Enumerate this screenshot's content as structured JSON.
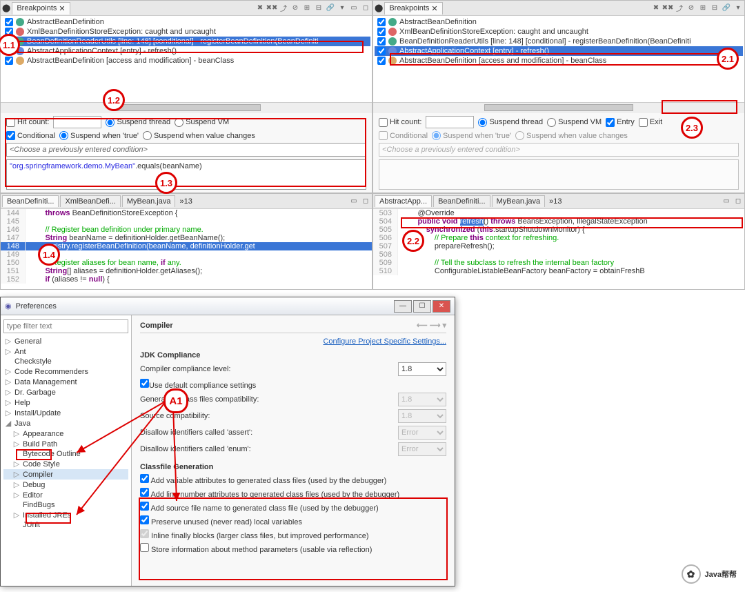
{
  "bp_view": {
    "title": "Breakpoints",
    "items": [
      {
        "checked": true,
        "icon": "class",
        "label": "AbstractBeanDefinition"
      },
      {
        "checked": true,
        "icon": "exc",
        "label": "XmlBeanDefinitionStoreException: caught and uncaught"
      },
      {
        "checked": true,
        "icon": "line",
        "label": "BeanDefinitionReaderUtils [line: 148] [conditional] - registerBeanDefinition(BeanDefiniti"
      },
      {
        "checked": true,
        "icon": "meth",
        "label": "AbstractApplicationContext [entry] - refresh()"
      },
      {
        "checked": true,
        "icon": "watch",
        "label": "AbstractBeanDefinition [access and modification] - beanClass"
      }
    ],
    "hit_count_label": "Hit count:",
    "suspend_thread": "Suspend thread",
    "suspend_vm": "Suspend VM",
    "conditional_label": "Conditional",
    "suspend_true": "Suspend when 'true'",
    "suspend_change": "Suspend when value changes",
    "cond_placeholder": "<Choose a previously entered condition>",
    "cond_expr_lit": "\"org.springframework.demo.MyBean\"",
    "cond_expr_rest": ".equals(beanName)",
    "entry_label": "Entry",
    "exit_label": "Exit"
  },
  "editors": {
    "left_tabs": [
      "BeanDefiniti...",
      "XmlBeanDefi...",
      "MyBean.java"
    ],
    "left_overflow": "»13",
    "right_tabs": [
      "AbstractApp...",
      "BeanDefiniti...",
      "MyBean.java"
    ],
    "right_overflow": "»13",
    "left_lines": [
      {
        "n": "144",
        "code": "        throws BeanDefinitionStoreException {"
      },
      {
        "n": "145",
        "code": ""
      },
      {
        "n": "146",
        "code": "        // Register bean definition under primary name."
      },
      {
        "n": "147",
        "code": "        String beanName = definitionHolder.getBeanName();"
      },
      {
        "n": "148",
        "code": "        registry.registerBeanDefinition(beanName, definitionHolder.get"
      },
      {
        "n": "149",
        "code": ""
      },
      {
        "n": "150",
        "code": "        // Register aliases for bean name, if any."
      },
      {
        "n": "151",
        "code": "        String[] aliases = definitionHolder.getAliases();"
      },
      {
        "n": "152",
        "code": "        if (aliases != null) {"
      }
    ],
    "right_lines": [
      {
        "n": "503",
        "code": "        @Override"
      },
      {
        "n": "504",
        "code": "        public void refresh() throws BeansException, IllegalStateException"
      },
      {
        "n": "505",
        "code": "            synchronized (this.startupShutdownMonitor) {"
      },
      {
        "n": "506",
        "code": "                // Prepare this context for refreshing."
      },
      {
        "n": "507",
        "code": "                prepareRefresh();"
      },
      {
        "n": "508",
        "code": ""
      },
      {
        "n": "509",
        "code": "                // Tell the subclass to refresh the internal bean factory"
      },
      {
        "n": "510",
        "code": "                ConfigurableListableBeanFactory beanFactory = obtainFreshB"
      }
    ]
  },
  "prefs": {
    "title": "Preferences",
    "filter_placeholder": "type filter text",
    "tree": [
      {
        "d": 0,
        "t": "▷",
        "l": "General"
      },
      {
        "d": 0,
        "t": "▷",
        "l": "Ant"
      },
      {
        "d": 0,
        "t": "",
        "l": "Checkstyle"
      },
      {
        "d": 0,
        "t": "▷",
        "l": "Code Recommenders"
      },
      {
        "d": 0,
        "t": "▷",
        "l": "Data Management"
      },
      {
        "d": 0,
        "t": "▷",
        "l": "Dr. Garbage"
      },
      {
        "d": 0,
        "t": "▷",
        "l": "Help"
      },
      {
        "d": 0,
        "t": "▷",
        "l": "Install/Update"
      },
      {
        "d": 0,
        "t": "◢",
        "l": "Java",
        "sel": false
      },
      {
        "d": 1,
        "t": "▷",
        "l": "Appearance"
      },
      {
        "d": 1,
        "t": "▷",
        "l": "Build Path"
      },
      {
        "d": 1,
        "t": "",
        "l": "Bytecode Outline"
      },
      {
        "d": 1,
        "t": "▷",
        "l": "Code Style"
      },
      {
        "d": 1,
        "t": "▷",
        "l": "Compiler",
        "sel": true
      },
      {
        "d": 1,
        "t": "▷",
        "l": "Debug"
      },
      {
        "d": 1,
        "t": "▷",
        "l": "Editor"
      },
      {
        "d": 1,
        "t": "",
        "l": "FindBugs"
      },
      {
        "d": 1,
        "t": "▷",
        "l": "Installed JREs"
      },
      {
        "d": 1,
        "t": "",
        "l": "JUnit"
      }
    ],
    "page_title": "Compiler",
    "link": "Configure Project Specific Settings...",
    "jdk_heading": "JDK Compliance",
    "compiler_level_label": "Compiler compliance level:",
    "compiler_level_value": "1.8",
    "use_default": "Use default compliance settings",
    "gen_compat": "Generated .class files compatibility:",
    "src_compat": "Source compatibility:",
    "disallow_assert": "Disallow identifiers called 'assert':",
    "disallow_enum": "Disallow identifiers called 'enum':",
    "val_18": "1.8",
    "val_error": "Error",
    "classfile_heading": "Classfile Generation",
    "cg": [
      {
        "c": true,
        "l": "Add variable attributes to generated class files (used by the debugger)"
      },
      {
        "c": true,
        "l": "Add line number attributes to generated class files (used by the debugger)"
      },
      {
        "c": true,
        "l": "Add source file name to generated class file (used by the debugger)"
      },
      {
        "c": true,
        "l": "Preserve unused (never read) local variables"
      },
      {
        "c": true,
        "l": "Inline finally blocks (larger class files, but improved performance)",
        "dis": true
      },
      {
        "c": false,
        "l": "Store information about method parameters (usable via reflection)"
      }
    ]
  },
  "callouts": {
    "c11": "1.1",
    "c12": "1.2",
    "c13": "1.3",
    "c14": "1.4",
    "c21": "2.1",
    "c22": "2.2",
    "c23": "2.3",
    "a1": "A1"
  },
  "watermark": "Java帮帮"
}
